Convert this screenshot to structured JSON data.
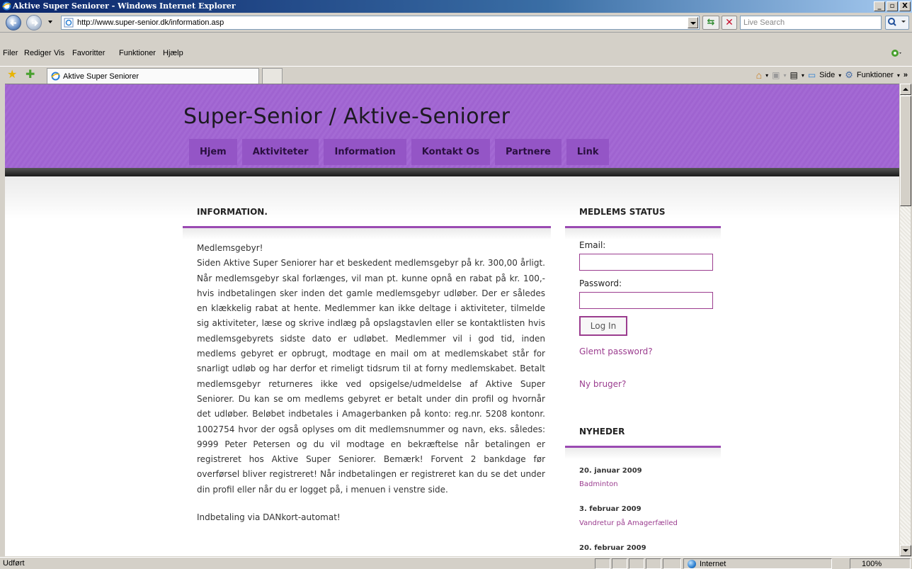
{
  "window": {
    "title": "Aktive Super Seniorer - Windows Internet Explorer",
    "minimize": "_",
    "maximize": "▫",
    "close": "X"
  },
  "address": {
    "url": "http://www.super-senior.dk/information.asp",
    "search_placeholder": "Live Search"
  },
  "menubar": {
    "items": [
      "Filer",
      "Rediger",
      "Vis",
      "Favoritter",
      "Funktioner",
      "Hjælp"
    ]
  },
  "tabbar": {
    "tab_title": "Aktive Super Seniorer",
    "side_label": "Side",
    "tools_label": "Funktioner",
    "more": "»"
  },
  "site": {
    "title": "Super-Senior / Aktive-Seniorer",
    "nav": [
      "Hjem",
      "Aktiviteter",
      "Information",
      "Kontakt Os",
      "Partnere",
      "Link"
    ]
  },
  "main": {
    "heading": "INFORMATION.",
    "subheading": "Medlemsgebyr!",
    "body": "Siden Aktive Super Seniorer har et beskedent medlemsgebyr på kr. 300,00 årligt. Når medlemsgebyr skal forlænges, vil man pt. kunne opnå en rabat på kr. 100,- hvis indbetalingen sker inden det gamle medlemsgebyr udløber. Der er således en klækkelig rabat at hente. Medlemmer kan ikke deltage i aktiviteter, tilmelde sig aktiviteter, læse og skrive indlæg på opslagstavlen eller se kontaktlisten hvis medlemsgebyrets sidste dato er udløbet. Medlemmer vil i god tid, inden medlems gebyret er opbrugt, modtage en mail om at medlemskabet står for snarligt udløb og har derfor et rimeligt tidsrum til at forny medlemskabet. Betalt medlemsgebyr returneres ikke ved opsigelse/udmeldelse af Aktive Super Seniorer. Du kan se om medlems gebyret er betalt under din profil og hvornår det udløber. Beløbet indbetales i Amagerbanken på konto: reg.nr. 5208 kontonr. 1002754 hvor der også oplyses om dit medlemsnummer og navn, eks. således: 9999 Peter Petersen og du vil modtage en bekræftelse når betalingen er registreret hos Aktive Super Seniorer. Bemærk! Forvent 2 bankdage før overførsel bliver registreret! Når indbetalingen er registreret kan du se det under din profil eller når du er logget på, i menuen i venstre side.",
    "subheading2": "Indbetaling via DANkort-automat!"
  },
  "member": {
    "heading": "MEDLEMS STATUS",
    "email_label": "Email:",
    "password_label": "Password:",
    "login_button": "Log In",
    "forgot_link": "Glemt password?",
    "new_user_link": "Ny bruger?"
  },
  "news": {
    "heading": "NYHEDER",
    "items": [
      {
        "date": "20. januar 2009",
        "title": "Badminton"
      },
      {
        "date": "3. februar 2009",
        "title": "Vandretur på Amagerfælled"
      },
      {
        "date": "20. februar 2009",
        "title": ""
      }
    ]
  },
  "status": {
    "text": "Udført",
    "zone": "Internet",
    "zoom": "100%"
  },
  "colors": {
    "header_purple": "#a46ad4",
    "nav_purple": "#9455c6",
    "accent": "#9b3d8f"
  }
}
